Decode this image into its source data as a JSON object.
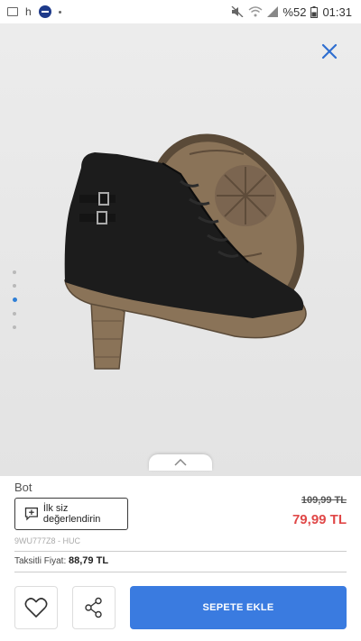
{
  "status_bar": {
    "left_icons": [
      "image-icon",
      "h",
      "app-circle-icon",
      "dot-icon"
    ],
    "h_text": "h",
    "battery": "%52",
    "time": "01:31",
    "right_icons": [
      "mute-icon",
      "wifi-icon",
      "signal-icon",
      "battery-icon"
    ]
  },
  "gallery": {
    "image_count": 5,
    "active_index": 2,
    "close_icon": "close-icon",
    "expand_icon": "chevron-up-icon"
  },
  "product": {
    "title": "Bot",
    "review_label": "İlk siz değerlendirin",
    "review_icon": "add-review-icon",
    "old_price": "109,99 TL",
    "new_price": "79,99 TL",
    "sku": "9WU777Z8 - HUC",
    "installment_label": "Taksitli Fiyat:",
    "installment_price": "88,79 TL",
    "price_color": "#e04848"
  },
  "actions": {
    "favorite_icon": "heart-icon",
    "share_icon": "share-icon",
    "add_to_cart": "SEPETE EKLE",
    "accent": "#3a7be0"
  }
}
